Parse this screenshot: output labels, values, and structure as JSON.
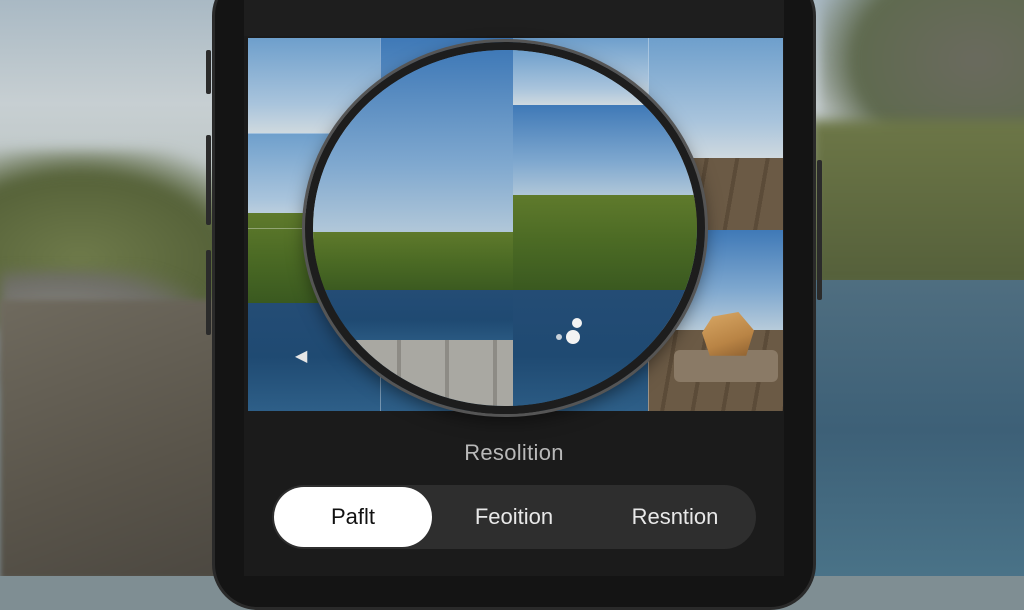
{
  "screen": {
    "section_title": "Resolition",
    "segmented_control": {
      "options": [
        "Paflt",
        "Feoition",
        "Resntion"
      ],
      "selected_index": 0
    },
    "preview": {
      "icons": [
        "magnifier-icon",
        "pan-indicator-icon",
        "chevron-left-icon"
      ]
    }
  },
  "colors": {
    "selected_background": "#ffffff",
    "control_background": "#2e2e2e",
    "label_text": "#b9b9b9"
  }
}
